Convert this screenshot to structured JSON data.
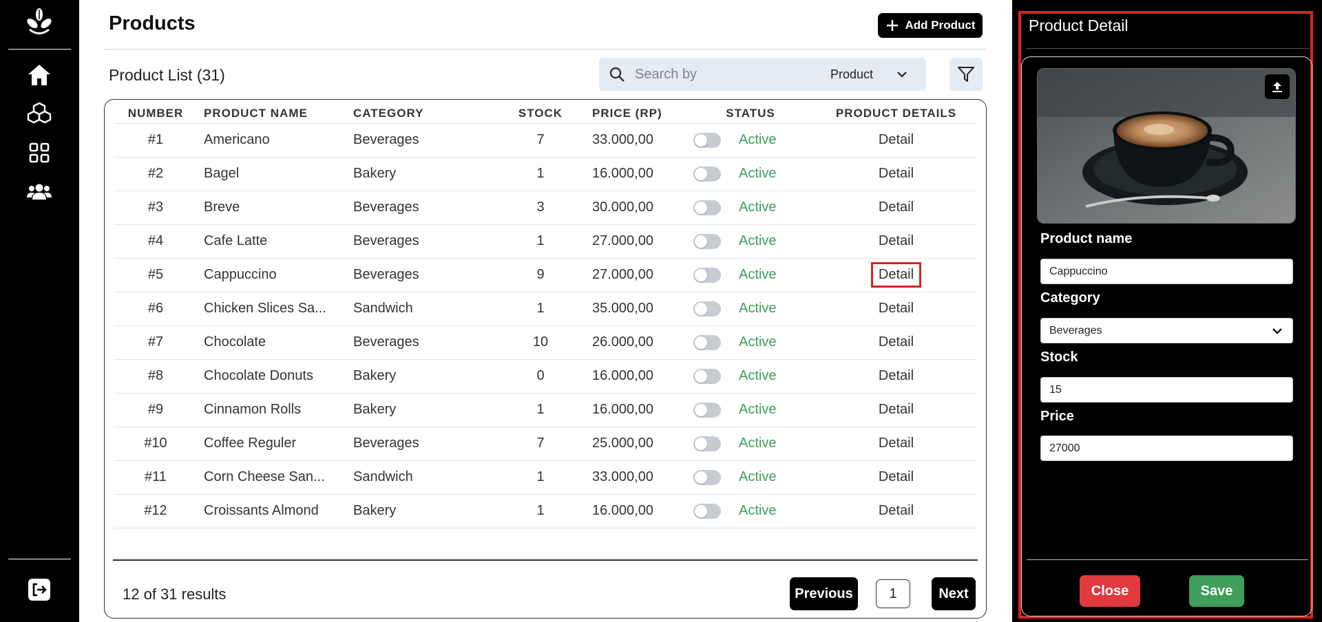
{
  "sidebar": {
    "nav": [
      {
        "name": "home-icon"
      },
      {
        "name": "cubes-icon"
      },
      {
        "name": "grid-icon"
      },
      {
        "name": "users-icon"
      }
    ]
  },
  "header": {
    "title": "Products",
    "add_button_label": "Add Product"
  },
  "list": {
    "title": "Product List (31)",
    "search_placeholder": "Search by",
    "search_field": "Product",
    "columns": [
      "NUMBER",
      "PRODUCT NAME",
      "CATEGORY",
      "STOCK",
      "PRICE (RP)",
      "STATUS",
      "PRODUCT DETAILS"
    ],
    "rows": [
      {
        "number": "#1",
        "name": "Americano",
        "category": "Beverages",
        "stock": "7",
        "price": "33.000,00",
        "status": "Active",
        "detail": "Detail"
      },
      {
        "number": "#2",
        "name": "Bagel",
        "category": "Bakery",
        "stock": "1",
        "price": "16.000,00",
        "status": "Active",
        "detail": "Detail"
      },
      {
        "number": "#3",
        "name": "Breve",
        "category": "Beverages",
        "stock": "3",
        "price": "30.000,00",
        "status": "Active",
        "detail": "Detail"
      },
      {
        "number": "#4",
        "name": "Cafe Latte",
        "category": "Beverages",
        "stock": "1",
        "price": "27.000,00",
        "status": "Active",
        "detail": "Detail"
      },
      {
        "number": "#5",
        "name": "Cappuccino",
        "category": "Beverages",
        "stock": "9",
        "price": "27.000,00",
        "status": "Active",
        "detail": "Detail"
      },
      {
        "number": "#6",
        "name": "Chicken Slices Sa...",
        "category": "Sandwich",
        "stock": "1",
        "price": "35.000,00",
        "status": "Active",
        "detail": "Detail"
      },
      {
        "number": "#7",
        "name": "Chocolate",
        "category": "Beverages",
        "stock": "10",
        "price": "26.000,00",
        "status": "Active",
        "detail": "Detail"
      },
      {
        "number": "#8",
        "name": "Chocolate Donuts",
        "category": "Bakery",
        "stock": "0",
        "price": "16.000,00",
        "status": "Active",
        "detail": "Detail"
      },
      {
        "number": "#9",
        "name": "Cinnamon Rolls",
        "category": "Bakery",
        "stock": "1",
        "price": "16.000,00",
        "status": "Active",
        "detail": "Detail"
      },
      {
        "number": "#10",
        "name": "Coffee Reguler",
        "category": "Beverages",
        "stock": "7",
        "price": "25.000,00",
        "status": "Active",
        "detail": "Detail"
      },
      {
        "number": "#11",
        "name": "Corn Cheese San...",
        "category": "Sandwich",
        "stock": "1",
        "price": "33.000,00",
        "status": "Active",
        "detail": "Detail"
      },
      {
        "number": "#12",
        "name": "Croissants Almond",
        "category": "Bakery",
        "stock": "1",
        "price": "16.000,00",
        "status": "Active",
        "detail": "Detail"
      }
    ],
    "results_text": "12 of 31 results",
    "prev_label": "Previous",
    "page": "1",
    "next_label": "Next"
  },
  "detail_panel": {
    "title": "Product Detail",
    "name_label": "Product name",
    "name_value": "Cappuccino",
    "category_label": "Category",
    "category_value": "Beverages",
    "stock_label": "Stock",
    "stock_value": "15",
    "price_label": "Price",
    "price_value": "27000",
    "close_label": "Close",
    "save_label": "Save"
  },
  "colors": {
    "active_status": "#3e9e5a",
    "highlight": "#e02020",
    "close_button": "#e0393e",
    "save_button": "#3e9e5a"
  }
}
